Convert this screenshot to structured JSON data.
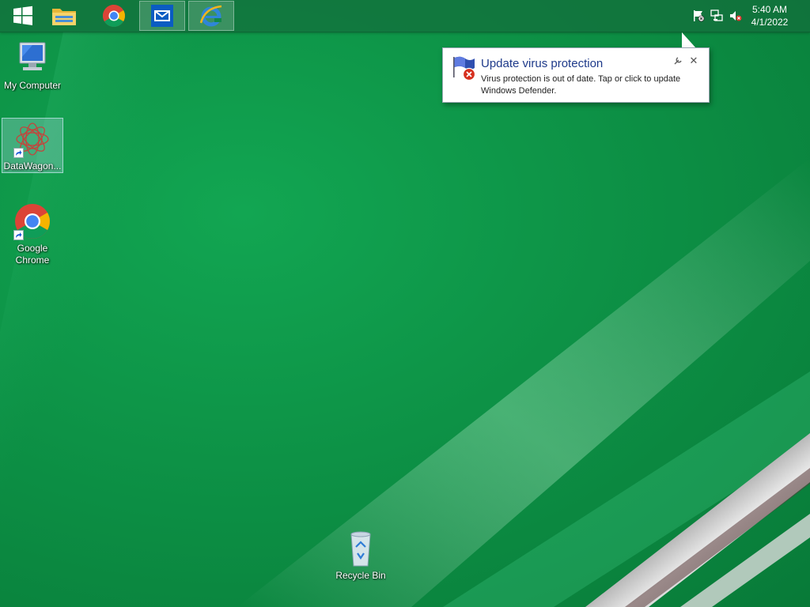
{
  "taskbar": {
    "start_icon": "windows-logo-icon",
    "pinned": [
      {
        "name": "file-explorer",
        "icon": "folder-icon"
      },
      {
        "name": "chrome",
        "icon": "chrome-icon"
      },
      {
        "name": "mail",
        "icon": "mail-icon"
      },
      {
        "name": "internet-explorer",
        "icon": "ie-icon"
      }
    ],
    "tray": {
      "icons": [
        "action-center-flag-icon",
        "network-icon",
        "volume-muted-icon"
      ],
      "time": "5:40 AM",
      "date": "4/1/2022"
    }
  },
  "desktop": {
    "icons": [
      {
        "label": "My Computer",
        "icon": "computer-icon"
      },
      {
        "label": "DataWagon...",
        "icon": "datawagon-icon",
        "selected": true
      },
      {
        "label": "Google Chrome",
        "icon": "chrome-icon"
      },
      {
        "label": "Recycle Bin",
        "icon": "recycle-bin-icon"
      }
    ]
  },
  "notification": {
    "title": "Update virus protection",
    "message": "Virus protection is out of date. Tap or click to update Windows Defender.",
    "icon": "security-flag-error-icon",
    "close_symbol": "✕"
  },
  "colors": {
    "desktop_green": "#0d9246",
    "notification_title": "#1e3a8a",
    "taskbar": "#146e3c"
  }
}
